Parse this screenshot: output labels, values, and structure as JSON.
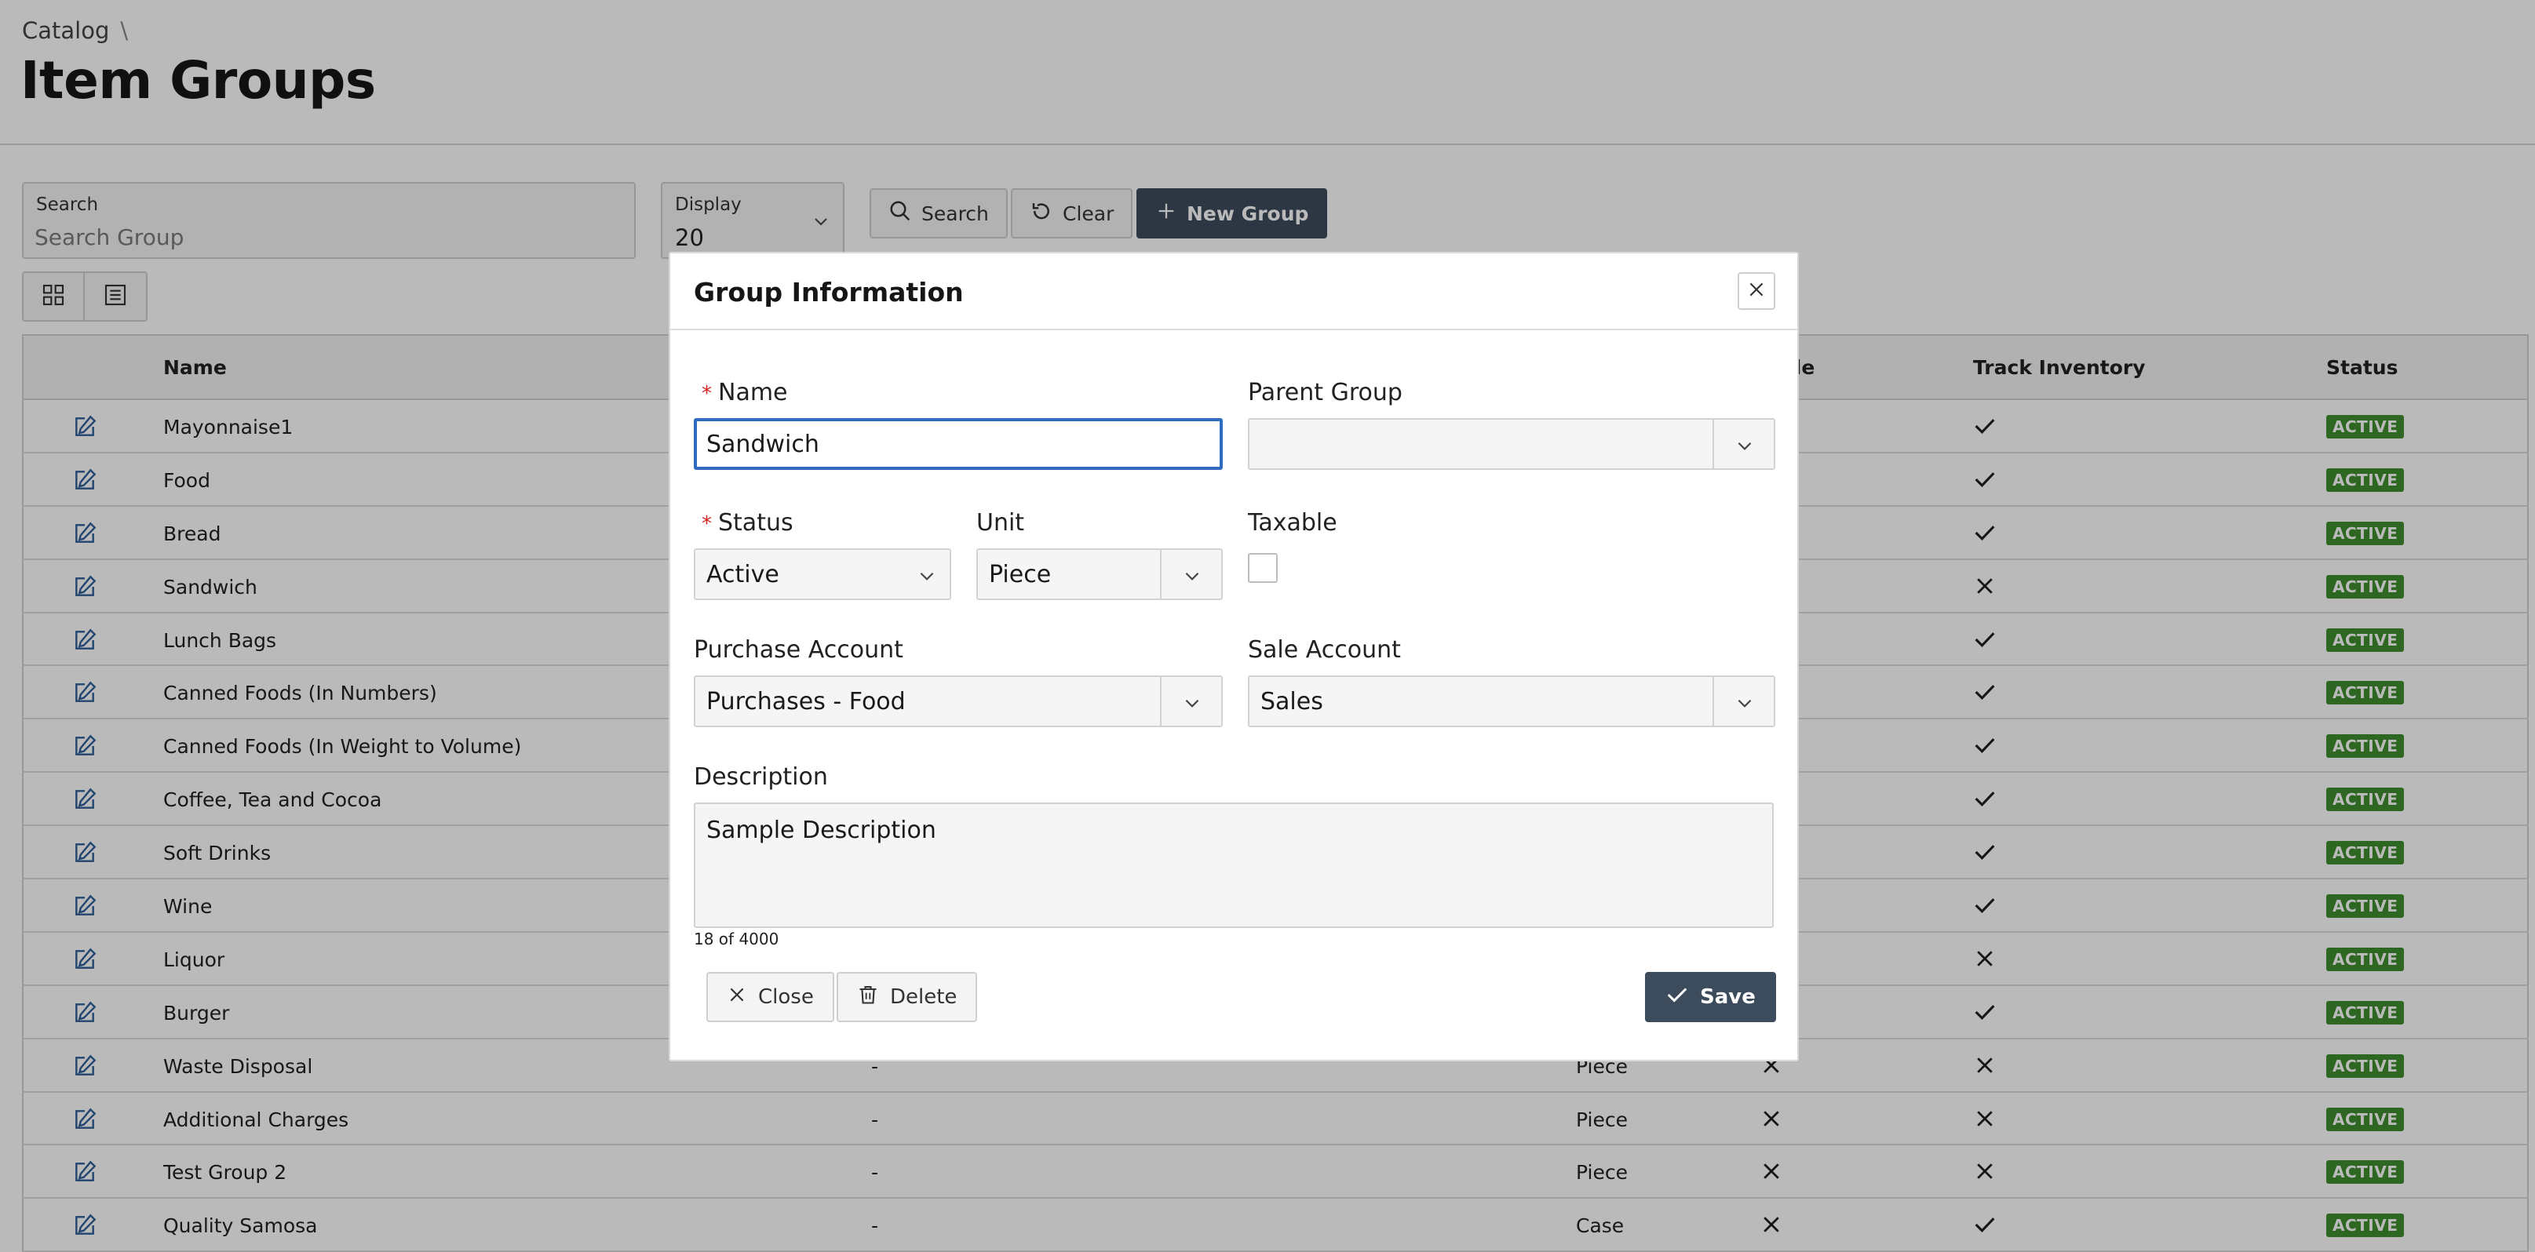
{
  "header": {
    "breadcrumb": "Catalog",
    "breadcrumb_sep": "\\",
    "title": "Item Groups"
  },
  "toolbar": {
    "search_label": "Search",
    "search_placeholder": "Search Group",
    "display_label": "Display",
    "display_value": "20",
    "search_button": "Search",
    "clear_button": "Clear",
    "new_group_button": "New Group"
  },
  "table": {
    "columns": {
      "name": "Name",
      "taxable_partial": "able",
      "track_inventory": "Track Inventory",
      "status": "Status"
    },
    "rows": [
      {
        "name": "Mayonnaise1",
        "parent": "",
        "unit": "",
        "taxable": "",
        "track": "check",
        "status": "ACTIVE"
      },
      {
        "name": "Food",
        "parent": "",
        "unit": "",
        "taxable": "",
        "track": "check",
        "status": "ACTIVE"
      },
      {
        "name": "Bread",
        "parent": "",
        "unit": "",
        "taxable": "",
        "track": "check",
        "status": "ACTIVE"
      },
      {
        "name": "Sandwich",
        "parent": "",
        "unit": "",
        "taxable": "",
        "track": "cross",
        "status": "ACTIVE"
      },
      {
        "name": "Lunch Bags",
        "parent": "",
        "unit": "",
        "taxable": "",
        "track": "check",
        "status": "ACTIVE"
      },
      {
        "name": "Canned Foods (In Numbers)",
        "parent": "",
        "unit": "",
        "taxable": "",
        "track": "check",
        "status": "ACTIVE"
      },
      {
        "name": "Canned Foods (In Weight to Volume)",
        "parent": "",
        "unit": "",
        "taxable": "",
        "track": "check",
        "status": "ACTIVE"
      },
      {
        "name": "Coffee, Tea and Cocoa",
        "parent": "",
        "unit": "",
        "taxable": "",
        "track": "check",
        "status": "ACTIVE"
      },
      {
        "name": "Soft Drinks",
        "parent": "",
        "unit": "",
        "taxable": "",
        "track": "check",
        "status": "ACTIVE"
      },
      {
        "name": "Wine",
        "parent": "",
        "unit": "",
        "taxable": "",
        "track": "check",
        "status": "ACTIVE"
      },
      {
        "name": "Liquor",
        "parent": "",
        "unit": "",
        "taxable": "",
        "track": "cross",
        "status": "ACTIVE"
      },
      {
        "name": "Burger",
        "parent": "",
        "unit": "",
        "taxable": "",
        "track": "check",
        "status": "ACTIVE"
      },
      {
        "name": "Waste Disposal",
        "parent": "-",
        "unit": "Piece",
        "taxable": "cross",
        "track": "cross",
        "status": "ACTIVE"
      },
      {
        "name": "Additional Charges",
        "parent": "-",
        "unit": "Piece",
        "taxable": "cross",
        "track": "cross",
        "status": "ACTIVE"
      },
      {
        "name": "Test Group 2",
        "parent": "-",
        "unit": "Piece",
        "taxable": "cross",
        "track": "cross",
        "status": "ACTIVE"
      },
      {
        "name": "Quality Samosa",
        "parent": "-",
        "unit": "Case",
        "taxable": "cross",
        "track": "check",
        "status": "ACTIVE"
      }
    ]
  },
  "modal": {
    "title": "Group Information",
    "required_mark": "*",
    "name_label": "Name",
    "name_value": "Sandwich",
    "parent_group_label": "Parent Group",
    "parent_group_value": "",
    "status_label": "Status",
    "status_value": "Active",
    "unit_label": "Unit",
    "unit_value": "Piece",
    "taxable_label": "Taxable",
    "purchase_account_label": "Purchase Account",
    "purchase_account_value": "Purchases - Food",
    "sale_account_label": "Sale Account",
    "sale_account_value": "Sales",
    "description_label": "Description",
    "description_value": "Sample Description",
    "char_counter": "18 of 4000",
    "close_button": "Close",
    "delete_button": "Delete",
    "save_button": "Save"
  },
  "colors": {
    "primary_button": "#3d4c5c",
    "active_badge": "#3e8e2e",
    "focus_border": "#2f6cc0",
    "required": "#d92020"
  }
}
